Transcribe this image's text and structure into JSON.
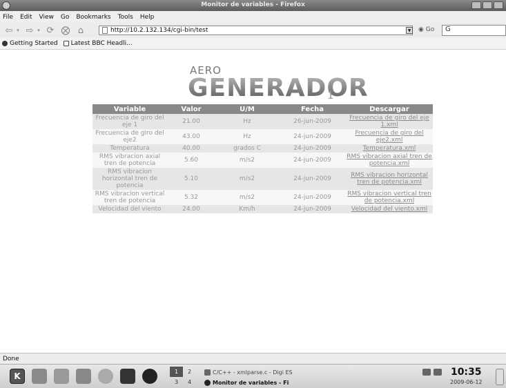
{
  "window": {
    "title": "Monitor de variables - Firefox"
  },
  "menu": {
    "items": [
      "File",
      "Edit",
      "View",
      "Go",
      "Bookmarks",
      "Tools",
      "Help"
    ]
  },
  "nav": {
    "url": "http://10.2.132.134/cgi-bin/test",
    "go_label": "Go",
    "search_value": "G"
  },
  "bookmarks": {
    "items": [
      "Getting Started",
      "Latest BBC Headli..."
    ]
  },
  "logo": {
    "prefix": "AERO",
    "main": "GENERADOR",
    "suffix": "1"
  },
  "table": {
    "headers": [
      "Variable",
      "Valor",
      "U/M",
      "Fecha",
      "Descargar"
    ],
    "rows": [
      [
        "Frecuencia de giro del eje 1",
        "21.00",
        "Hz",
        "26-jun-2009",
        "Frecuencia de giro del eje 1.xml"
      ],
      [
        "Frecuencia de giro del eje2",
        "43.00",
        "Hz",
        "24-jun-2009",
        "Frecuencia de giro del eje2.xml"
      ],
      [
        "Temperatura",
        "40.00",
        "grados C",
        "24-jun-2009",
        "Temperatura.xml"
      ],
      [
        "RMS vibracion axial tren de potencia",
        "5.60",
        "m/s2",
        "24-jun-2009",
        "RMS vibracion axial tren de potencia.xml"
      ],
      [
        "RMS vibracion horizontal tren de potencia",
        "5.10",
        "m/s2",
        "24-jun-2009",
        "RMS vibracion horizontal tren de potencia.xml"
      ],
      [
        "RMS vibracion vertical tren de potencia",
        "5.32",
        "m/s2",
        "24-jun-2009",
        "RMS vibracion vertical tren de potencia.xml"
      ],
      [
        "Velocidad del viento",
        "24.00",
        "Km/h",
        "24-jun-2009",
        "Velocidad del viento.xml"
      ]
    ]
  },
  "status": {
    "text": "Done"
  },
  "taskbar": {
    "pager": [
      "1",
      "2",
      "3",
      "4"
    ],
    "tasks": [
      "C/C++ - xmlparse.c - Digi ES",
      "Monitor de variables - Fi"
    ],
    "time": "10:35",
    "date": "2009-06-12"
  }
}
